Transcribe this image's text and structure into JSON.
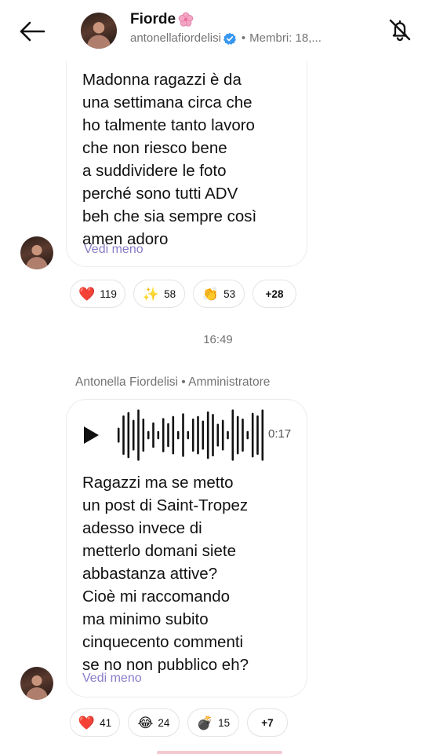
{
  "header": {
    "title": "Fiorde",
    "subtitle_handle": "antonellafiordelisi",
    "subtitle_members": "Membri: 18,...",
    "separator": "•"
  },
  "messages": [
    {
      "text": "Madonna ragazzi è da\nuna settimana circa che\nho talmente tanto lavoro\nche non riesco bene\na suddividere le foto\nperché sono tutti ADV\nbeh che sia sempre così\namen adoro",
      "see_less": "Vedi meno",
      "reactions": [
        {
          "emoji": "❤️",
          "count": "119"
        },
        {
          "emoji": "✨",
          "count": "58"
        },
        {
          "emoji": "👏",
          "count": "53"
        },
        {
          "emoji": "",
          "count": "+28"
        }
      ]
    },
    {
      "audio_duration": "0:17",
      "text": "Ragazzi ma se metto\nun post di Saint-Tropez\nadesso invece di\nmetterlo domani siete\nabbastanza attive?\nCioè mi raccomando\nma minimo subito\ncinquecento commenti\nse no non pubblico eh?",
      "see_less": "Vedi meno",
      "reactions": [
        {
          "emoji": "❤️",
          "count": "41"
        },
        {
          "emoji": "😂",
          "count": "24"
        },
        {
          "emoji": "💣",
          "count": "15"
        },
        {
          "emoji": "",
          "count": "+7"
        }
      ]
    }
  ],
  "timestamp": "16:49",
  "sender": {
    "name": "Antonella Fiordelisi",
    "separator": "•",
    "role": "Amministratore"
  },
  "icons": {
    "back": "arrow-left-icon",
    "bell": "bell-off-icon",
    "verified": "verified-badge-icon",
    "play": "play-icon",
    "flower": "cherry-blossom-emoji"
  },
  "colors": {
    "accent": "#8a7cc9",
    "verified": "#3897f0",
    "secondary_text": "#737373"
  },
  "waveform": [
    0.25,
    0.72,
    0.85,
    0.55,
    0.95,
    0.6,
    0.12,
    0.45,
    0.12,
    0.62,
    0.42,
    0.7,
    0.12,
    0.8,
    0.12,
    0.6,
    0.7,
    0.52,
    0.88,
    0.78,
    0.4,
    0.55,
    0.12,
    0.95,
    0.7,
    0.6,
    0.12,
    0.82,
    0.72,
    0.95
  ]
}
